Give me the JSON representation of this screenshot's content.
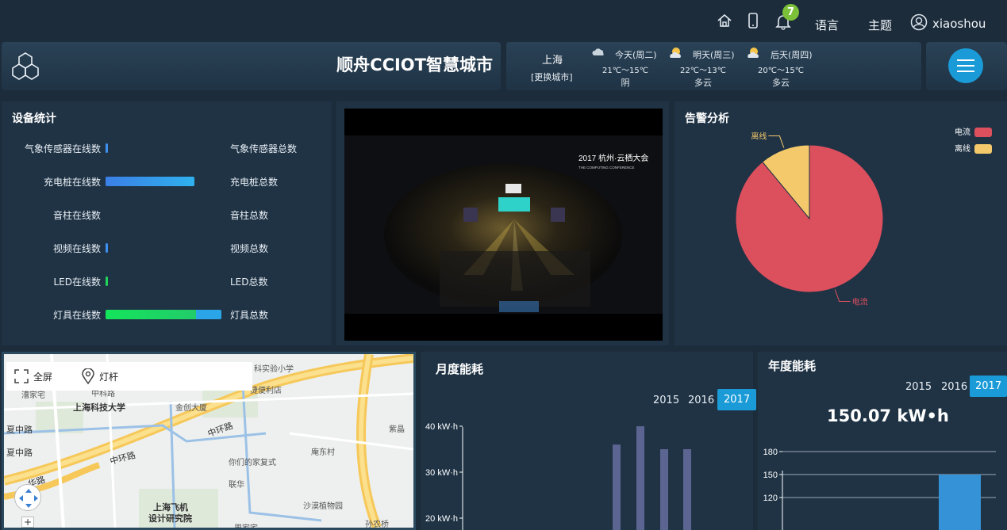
{
  "topbar": {
    "notification_count": "7",
    "language_label": "语言",
    "theme_label": "主题",
    "username": "xiaoshou"
  },
  "header": {
    "title": "顺舟CCIOT智慧城市",
    "weather": {
      "city": "上海",
      "change_city": "[更换城市]",
      "days": [
        {
          "label": "今天(周二)",
          "temp": "21℃～15℃",
          "cond": "阴",
          "icon": "cloud-icon"
        },
        {
          "label": "明天(周三)",
          "temp": "22℃～13℃",
          "cond": "多云",
          "icon": "sun-cloud-icon"
        },
        {
          "label": "后天(周四)",
          "temp": "20℃～15℃",
          "cond": "多云",
          "icon": "sun-cloud-icon"
        }
      ]
    }
  },
  "device_stats": {
    "title": "设备统计",
    "rows": [
      {
        "online_label": "气象传感器在线数",
        "total_label": "气象传感器总数",
        "online_ratio": 0.02,
        "total_ratio": 0
      },
      {
        "online_label": "充电桩在线数",
        "total_label": "充电桩总数",
        "online_ratio": 0.77,
        "total_ratio": 0
      },
      {
        "online_label": "音柱在线数",
        "total_label": "音柱总数",
        "online_ratio": 0,
        "total_ratio": 0
      },
      {
        "online_label": "视频在线数",
        "total_label": "视频总数",
        "online_ratio": 0.02,
        "total_ratio": 0
      },
      {
        "online_label": "LED在线数",
        "total_label": "LED总数",
        "online_ratio": 0.02,
        "total_ratio": 0
      },
      {
        "online_label": "灯具在线数",
        "total_label": "灯具总数",
        "online_ratio": 1.0,
        "total_ratio": 0
      }
    ]
  },
  "video": {
    "overlay_title": "2017 杭州·云栖大会",
    "overlay_subtitle": "THE COMPUTING CONFERENCE"
  },
  "alarm": {
    "title": "告警分析",
    "legend": [
      {
        "name": "电流",
        "color": "#dc4f5d"
      },
      {
        "name": "离线",
        "color": "#f4c96b"
      }
    ]
  },
  "map": {
    "fullscreen_label": "全屏",
    "pole_label": "灯杆",
    "labels": [
      "科实验小学",
      "捷便利店",
      "漕家宅",
      "中科路",
      "上海科技大学",
      "金创大厦",
      "夏中路",
      "中环路",
      "夏中路",
      "中环路",
      "华路",
      "你们的家复式",
      "庵东村",
      "联华",
      "上海飞机",
      "设计研究院",
      "沙漠植物园",
      "紫晶",
      "周家宅",
      "孙农桥"
    ]
  },
  "monthly": {
    "title": "月度能耗",
    "years": [
      "2015",
      "2016",
      "2017"
    ],
    "active_year": "2017"
  },
  "yearly": {
    "title": "年度能耗",
    "years": [
      "2015",
      "2016",
      "2017"
    ],
    "active_year": "2017",
    "total": "150.07 kW•h"
  },
  "chart_data": [
    {
      "type": "pie",
      "title": "告警分析",
      "categories": [
        "电流",
        "离线"
      ],
      "values": [
        89,
        11
      ],
      "colors": [
        "#dc4f5d",
        "#f4c96b"
      ],
      "legend": "top-right"
    },
    {
      "type": "bar",
      "title": "月度能耗",
      "yticks": [
        "20 kW·h",
        "30 kW·h",
        "40 kW·h"
      ],
      "ylim": [
        0,
        40
      ],
      "values": [
        36,
        40,
        35,
        35
      ],
      "color": "#5c6591"
    },
    {
      "type": "bar",
      "title": "年度能耗",
      "yticks": [
        "120",
        "150",
        "180"
      ],
      "ylim": [
        0,
        180
      ],
      "values": [
        150
      ],
      "color": "#3592d6"
    }
  ]
}
